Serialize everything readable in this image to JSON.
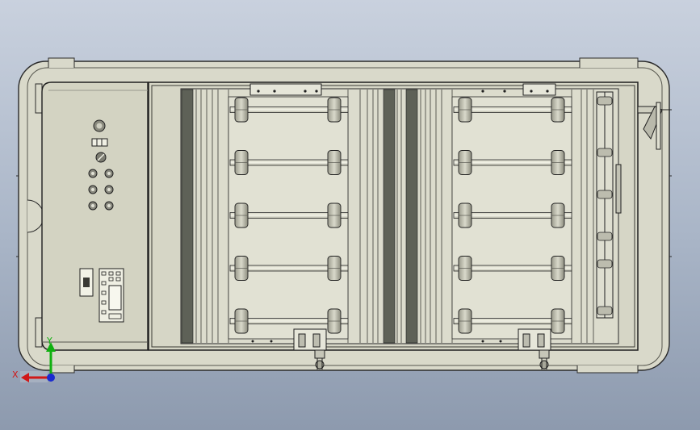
{
  "scene": {
    "kind": "cad-top-view",
    "colors": {
      "background_top": "#c9d1de",
      "background_bottom": "#8d9aae",
      "housing": "#dadacb",
      "panel": "#d3d3c3",
      "outline": "#2a2a2a",
      "dark_strip": "#5c5f55",
      "axis_x": "#d01818",
      "axis_y": "#10b010",
      "axis_origin": "#1a2ad0"
    },
    "control_panel": {
      "knobs": 2,
      "switch": 1,
      "indicator_lights": 6,
      "usb_port": 1,
      "keypad": 1
    },
    "roller_modules": 2,
    "roller_rows_per_module": 5,
    "handle": 1,
    "clamp_feet": 2
  },
  "axes": {
    "x_label": "X",
    "y_label": "Y"
  }
}
